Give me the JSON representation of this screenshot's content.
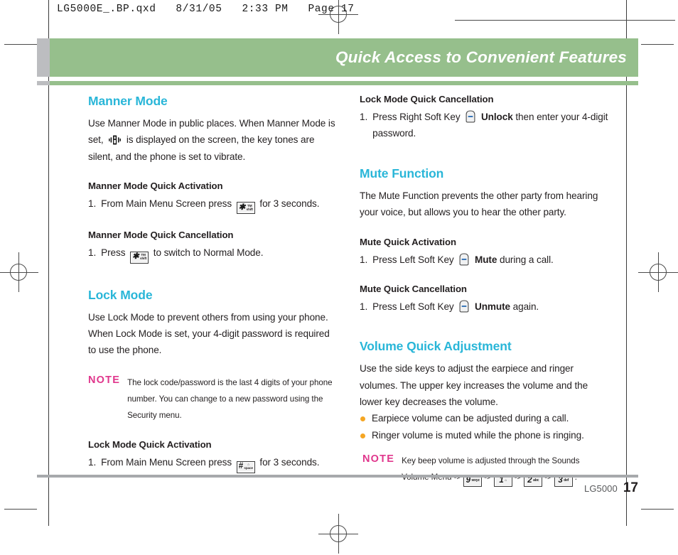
{
  "slug": {
    "text": "LG5000E_.BP.qxd   8/31/05   2:33 PM   Page 17"
  },
  "banner": {
    "title": "Quick Access to Convenient Features",
    "color": "#96bf8c",
    "tab_color": "#bcbdc0",
    "title_color": "#ffffff"
  },
  "colors": {
    "heading": "#29b6d8",
    "note_label": "#e0368c",
    "bullet": "#f5a623",
    "body": "#231f20",
    "rule": "#a7a9ac"
  },
  "left_column": {
    "manner_mode": {
      "heading": "Manner Mode",
      "body_part1": "Use Manner Mode in public places. When Manner Mode is set,",
      "body_part2": "is displayed on the screen, the key tones are silent, and the phone is set to vibrate.",
      "icon": "vibrate-icon",
      "quick_activation": {
        "heading": "Manner Mode Quick Activation",
        "step_number": "1.",
        "step_part1": "From Main Menu Screen press",
        "step_part2": "for 3 seconds.",
        "key": {
          "main": "✱",
          "sub_top": "TM",
          "sub_bottom": "shift"
        }
      },
      "quick_cancellation": {
        "heading": "Manner Mode Quick Cancellation",
        "step_number": "1.",
        "step_part1": "Press",
        "step_part2": "to switch to Normal Mode.",
        "key": {
          "main": "✱",
          "sub_top": "TM",
          "sub_bottom": "shift"
        }
      }
    },
    "lock_mode": {
      "heading": "Lock Mode",
      "body": "Use Lock Mode to prevent others from using your phone. When Lock Mode is set, your 4-digit password is required to use the phone.",
      "note": {
        "label": "NOTE",
        "text": "The lock code/password is the last 4 digits of your phone number. You can change to a new password using the Security menu."
      },
      "quick_activation": {
        "heading": "Lock Mode Quick Activation",
        "step_number": "1.",
        "step_part1": "From Main Menu Screen press",
        "step_part2": "for 3 seconds.",
        "key": {
          "main": "#",
          "sub_top": "⌂",
          "sub_bottom": "space"
        }
      }
    }
  },
  "right_column": {
    "lock_mode_cancellation": {
      "heading": "Lock Mode Quick Cancellation",
      "step_number": "1.",
      "step_part1": "Press Right Soft Key",
      "step_bold": "Unlock",
      "step_part2": "then enter your 4-digit password.",
      "icon": "soft-key-icon"
    },
    "mute_function": {
      "heading": "Mute Function",
      "body": "The Mute Function prevents the other party from hearing your voice, but allows you to hear the other party.",
      "quick_activation": {
        "heading": "Mute Quick Activation",
        "step_number": "1.",
        "step_part1": "Press Left Soft Key",
        "step_bold": "Mute",
        "step_part2": "during a call.",
        "icon": "soft-key-icon"
      },
      "quick_cancellation": {
        "heading": "Mute Quick Cancellation",
        "step_number": "1.",
        "step_part1": "Press Left Soft Key",
        "step_bold": "Unmute",
        "step_part2": "again.",
        "icon": "soft-key-icon"
      }
    },
    "volume_adjustment": {
      "heading": "Volume Quick Adjustment",
      "body": "Use the side keys to adjust the earpiece and ringer volumes. The upper key increases the volume and the lower key decreases the volume.",
      "bullets": [
        "Earpiece volume can be adjusted during a call.",
        "Ringer volume is muted while the phone is ringing."
      ],
      "note": {
        "label": "NOTE",
        "text_line1": "Key beep volume is adjusted through the Sounds",
        "text_line2_prefix": "Volume Menu ->",
        "arrow": "->",
        "trailing": ".",
        "keys": [
          {
            "main": "9",
            "sub": "wxyz"
          },
          {
            "main": "1",
            "sub": "⌂"
          },
          {
            "main": "2",
            "sub": "abc"
          },
          {
            "main": "3",
            "sub": "def"
          }
        ]
      }
    }
  },
  "footer": {
    "model": "LG5000",
    "page": "17"
  }
}
